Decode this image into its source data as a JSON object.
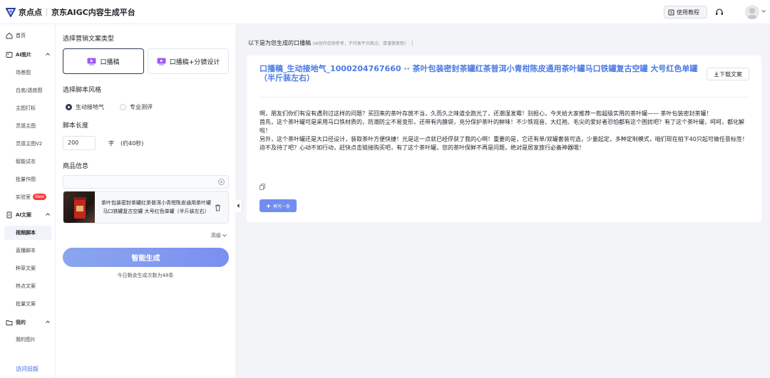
{
  "header": {
    "logo_name": "京点点",
    "platform": "京东AIGC内容生成平台",
    "tutorial_label": "使用教程"
  },
  "sidebar": {
    "items": [
      {
        "label": "首页",
        "type": "top"
      },
      {
        "label": "AI图片",
        "type": "group"
      },
      {
        "label": "场景图",
        "type": "sub"
      },
      {
        "label": "白底/透底图",
        "type": "sub"
      },
      {
        "label": "主图打标",
        "type": "sub"
      },
      {
        "label": "灵感主图",
        "type": "sub"
      },
      {
        "label": "灵感主图V2",
        "type": "sub"
      },
      {
        "label": "智能试衣",
        "type": "sub"
      },
      {
        "label": "批量作图",
        "type": "sub"
      },
      {
        "label": "实验室",
        "type": "sub"
      },
      {
        "label": "AI文案",
        "type": "group"
      },
      {
        "label": "视频脚本",
        "type": "sub",
        "active": true
      },
      {
        "label": "直播脚本",
        "type": "sub"
      },
      {
        "label": "种草文案",
        "type": "sub"
      },
      {
        "label": "热点文案",
        "type": "sub"
      },
      {
        "label": "批量文案",
        "type": "sub"
      },
      {
        "label": "我的",
        "type": "group"
      },
      {
        "label": "我的图片",
        "type": "sub"
      }
    ],
    "new_badge": "New",
    "old_version": "访问旧版"
  },
  "panel": {
    "type_title": "选择营销文案类型",
    "type_options": [
      "口播稿",
      "口播稿+分镜设计"
    ],
    "style_title": "选择脚本风格",
    "style_options": [
      "生动接地气",
      "专业测评"
    ],
    "length_title": "脚本长度",
    "length_value": "200",
    "length_unit": "字",
    "length_hint": "(约40秒)",
    "product_title": "商品信息",
    "product_name": "茶叶包装密封茶罐红茶普洱小青柑陈皮通用茶叶罐马口铁罐复古空罐 大号红色单罐（半斤装左右）",
    "advanced": "高级",
    "generate": "智能生成",
    "remain": "今日剩余生成次数为48条"
  },
  "result": {
    "head": "以下是为您生成的口播稿",
    "head_note": "(AI创作仅供参考，不代表平台观点，请谨慎使用)",
    "title": "口播稿_生动接地气_1000204767660 ·· 茶叶包装密封茶罐红茶普洱小青柑陈皮通用茶叶罐马口铁罐复古空罐 大号红色单罐（半斤装左右）",
    "download": "下载文案",
    "paragraphs": [
      "啊，朋友们你们有没有遇到过这样的问题？买回来的茶叶存放不当，久而久之味道全跑光了，还潮湿发霉！别担心，今天给大家推荐一款超级实用的茶叶罐——            茶叶包装密封茶罐！",
      "首先，这个茶叶罐可是采用马口铁材质的，防潮防尘不易变形，还带有内膜袋，充分保护茶叶的鲜味！不少铁观音、大红袍、毛尖的爱好者恐怕都有这个困扰吧？有了这个茶叶罐，呵呵，都化解啦！",
      "另外，这个茶叶罐还是大口径设计，装取茶叶方便快捷！光是这一点就已经俘获了我的心啊！重要的是，它还有单/双罐套装可选，少量起定，多种定制模式，咱们现在拍下40只起可做任意标签！",
      "迫不及待了吧？心动不如行动，赶快点击链接购买吧，有了这个茶叶罐，您的茶叶保鲜不再是问题，绝对是居家旅行必备神器哦！"
    ],
    "rewrite": "再写一条"
  },
  "colors": {
    "accent": "#4a7ae6",
    "button_gradient_start": "#8aa6ee",
    "button_gradient_end": "#7b8ff0",
    "badge": "#f23d3d"
  }
}
